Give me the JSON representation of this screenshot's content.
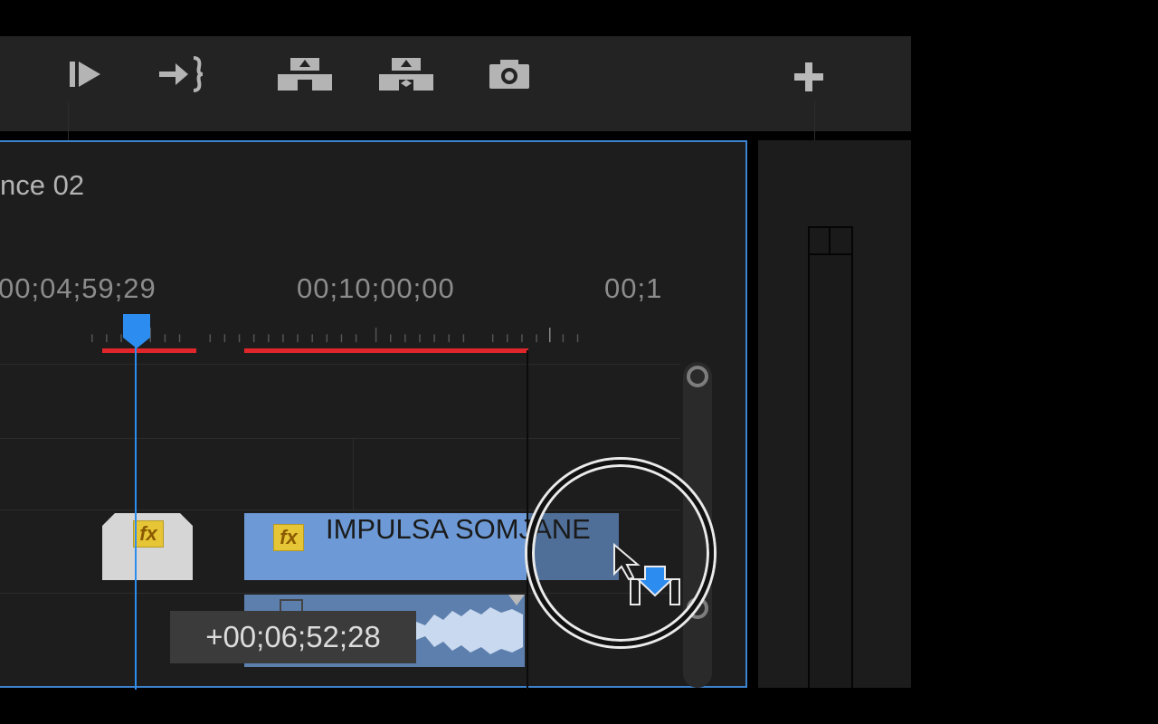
{
  "toolbar": {
    "buttons": [
      "play-in-to-out",
      "go-to-out",
      "lift",
      "extract",
      "export-frame",
      "add"
    ],
    "add_label": "+"
  },
  "timeline": {
    "sequence_title": "nce 02",
    "timecodes": [
      "00;04;59;29",
      "00;10;00;00",
      "00;1"
    ],
    "clip": {
      "name": "IMPULSA SOMJANE",
      "fx_label": "fx"
    },
    "small_clip_fx_label": "fx",
    "tooltip": "+00;06;52;28"
  },
  "colors": {
    "accent": "#3d83cf",
    "playhead": "#2d8cf0",
    "render_bar": "#e0262a",
    "video_clip": "#6d9ad6",
    "fx_badge": "#e6c637"
  }
}
